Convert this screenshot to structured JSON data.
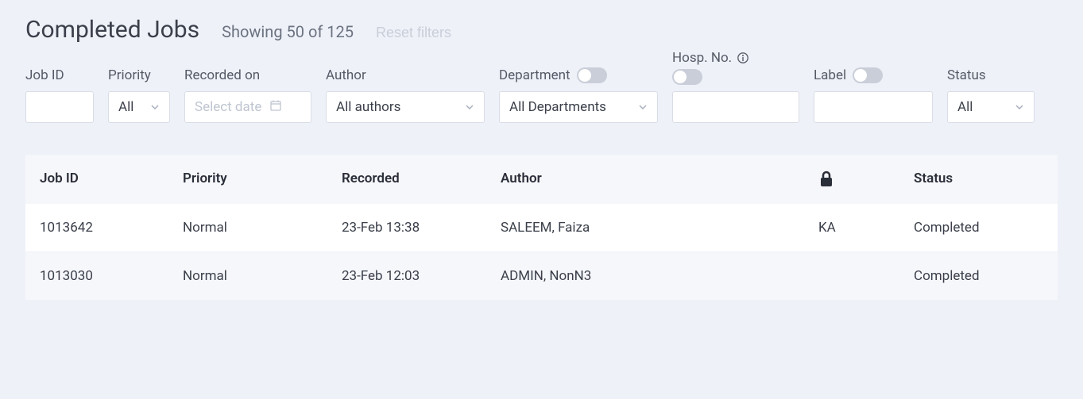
{
  "header": {
    "title": "Completed Jobs",
    "showing": "Showing 50 of 125",
    "reset": "Reset filters"
  },
  "filters": {
    "job_id": {
      "label": "Job ID",
      "value": ""
    },
    "priority": {
      "label": "Priority",
      "value": "All"
    },
    "recorded_on": {
      "label": "Recorded on",
      "placeholder": "Select date"
    },
    "author": {
      "label": "Author",
      "value": "All authors"
    },
    "department": {
      "label": "Department",
      "value": "All Departments"
    },
    "hosp_no": {
      "label": "Hosp. No.",
      "value": ""
    },
    "label_field": {
      "label": "Label",
      "value": ""
    },
    "status": {
      "label": "Status",
      "value": "All"
    }
  },
  "columns": {
    "job_id": "Job ID",
    "priority": "Priority",
    "recorded": "Recorded",
    "author": "Author",
    "status": "Status"
  },
  "rows": [
    {
      "job_id": "1013642",
      "priority": "Normal",
      "recorded": "23-Feb 13:38",
      "author": "SALEEM, Faiza",
      "lock": "KA",
      "status": "Completed"
    },
    {
      "job_id": "1013030",
      "priority": "Normal",
      "recorded": "23-Feb 12:03",
      "author": "ADMIN, NonN3",
      "lock": "",
      "status": "Completed"
    }
  ]
}
